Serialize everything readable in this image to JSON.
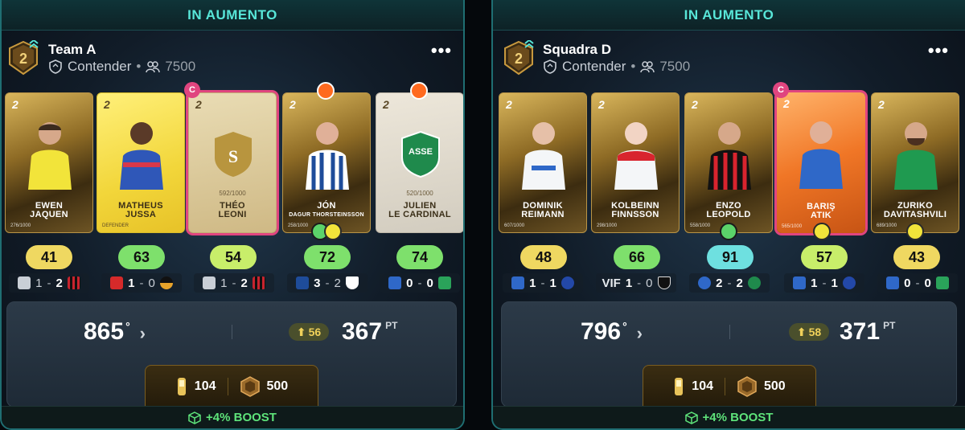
{
  "panels": [
    {
      "rising_label": "IN AUMENTO",
      "badge_level": "2",
      "team_name": "Team A",
      "division": "Contender",
      "members": "7500",
      "more_label": "•••",
      "cards": [
        {
          "type": "gold",
          "name_line1": "EWEN",
          "name_line2": "JAQUEN",
          "serial": "276/1000"
        },
        {
          "type": "yellow",
          "name_line1": "MATHEUS",
          "name_line2": "JUSSA",
          "serial": "DEFENDER"
        },
        {
          "type": "blank",
          "name_line1": "THÉO",
          "name_line2": "LEONI",
          "serial": "592/1000",
          "captain": true
        },
        {
          "type": "gold",
          "name_line1": "JÓN",
          "name_line2": "DAGUR THORSTEINSSON",
          "serial": "258/1000"
        },
        {
          "type": "blank-grey",
          "name_line1": "JULIEN",
          "name_line2": "LE CARDINAL",
          "serial": "520/1000"
        }
      ],
      "scores": [
        "41",
        "63",
        "54",
        "72",
        "74"
      ],
      "matches": [
        {
          "home": "1",
          "away": "2"
        },
        {
          "home": "1",
          "away": "0"
        },
        {
          "home": "1",
          "away": "2"
        },
        {
          "home": "3",
          "away": "2"
        },
        {
          "home": "0",
          "away": "0"
        }
      ],
      "rank": "865",
      "rank_unit": "°",
      "delta": "56",
      "points": "367",
      "points_unit": "PT",
      "essence": "104",
      "coins": "500",
      "boost": "+4% BOOST"
    },
    {
      "rising_label": "IN AUMENTO",
      "badge_level": "2",
      "team_name": "Squadra D",
      "division": "Contender",
      "members": "7500",
      "more_label": "•••",
      "cards": [
        {
          "type": "gold",
          "name_line1": "DOMINIK",
          "name_line2": "REIMANN",
          "serial": "607/1000"
        },
        {
          "type": "gold",
          "name_line1": "KOLBEINN",
          "name_line2": "FINNSSON",
          "serial": "298/1000"
        },
        {
          "type": "gold",
          "name_line1": "ENZO",
          "name_line2": "LEOPOLD",
          "serial": "558/1000"
        },
        {
          "type": "orange",
          "name_line1": "BARIŞ",
          "name_line2": "ATIK",
          "serial": "565/1000",
          "captain": true
        },
        {
          "type": "gold",
          "name_line1": "ZURIKO",
          "name_line2": "DAVITASHVILI",
          "serial": "689/1000"
        }
      ],
      "scores": [
        "48",
        "66",
        "91",
        "57",
        "43"
      ],
      "matches": [
        {
          "home": "1",
          "away": "1"
        },
        {
          "home": "1",
          "away": "0",
          "home_code": "VIF"
        },
        {
          "home": "2",
          "away": "2"
        },
        {
          "home": "1",
          "away": "1"
        },
        {
          "home": "0",
          "away": "0"
        }
      ],
      "rank": "796",
      "rank_unit": "°",
      "delta": "58",
      "points": "371",
      "points_unit": "PT",
      "essence": "104",
      "coins": "500",
      "boost": "+4% BOOST"
    }
  ],
  "captain_letter": "C",
  "colors": {
    "accent": "#58e6d8",
    "boost": "#5ee37a",
    "captain": "#e0457f",
    "delta": "#f0d15a"
  }
}
